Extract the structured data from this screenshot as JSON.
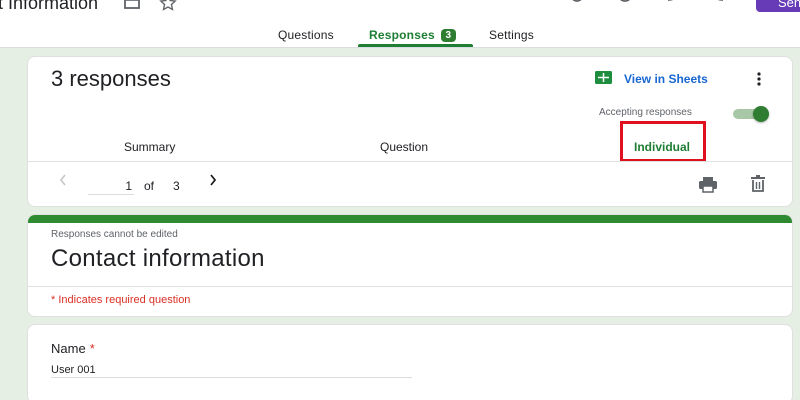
{
  "header": {
    "doc_title": "t Information",
    "send_label": "Sen",
    "tabs": [
      {
        "label": "Questions"
      },
      {
        "label": "Responses",
        "badge": "3"
      },
      {
        "label": "Settings"
      }
    ]
  },
  "summary_card": {
    "response_count": "3 responses",
    "sheets_link": "View in Sheets",
    "accepting_label": "Accepting responses",
    "accepting_on": true,
    "subtabs": [
      "Summary",
      "Question",
      "Individual"
    ],
    "active_subtab": "Individual",
    "pager": {
      "current": "1",
      "of_label": "of",
      "total": "3"
    }
  },
  "form_header": {
    "note": "Responses cannot be edited",
    "title": "Contact information",
    "required_note": "* Indicates required question"
  },
  "question": {
    "title": "Name",
    "required_mark": "*",
    "answer": "User 001"
  },
  "colors": {
    "accent": "#1e7e34",
    "brand": "#673ab7",
    "highlight": "#e01020",
    "required": "#d93025"
  },
  "icons": [
    "copy-icon",
    "star-icon",
    "palette-icon",
    "eye-icon",
    "undo-icon",
    "redo-icon",
    "sheets-icon",
    "more-vert-icon",
    "chevron-left-icon",
    "chevron-right-icon",
    "print-icon",
    "trash-icon"
  ]
}
